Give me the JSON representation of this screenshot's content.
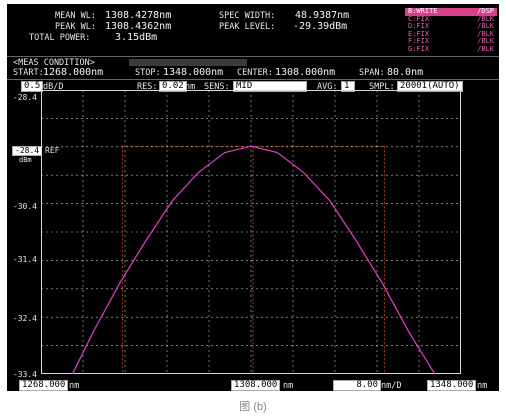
{
  "header": {
    "mean_wl_label": "MEAN WL:",
    "mean_wl_value": "1308.4278nm",
    "peak_wl_label": "PEAK WL:",
    "peak_wl_value": "1308.4362nm",
    "total_power_label": "TOTAL POWER:",
    "total_power_value": "3.15dBm",
    "spec_width_label": "SPEC WIDTH:",
    "spec_width_value": "48.9387nm",
    "peak_level_label": "PEAK LEVEL:",
    "peak_level_value": "-29.39dBm"
  },
  "traces": [
    {
      "name": "B:WRITE",
      "mode": "/DSP",
      "highlight": true
    },
    {
      "name": "C:FIX",
      "mode": "/BLK",
      "highlight": false
    },
    {
      "name": "D:FIX",
      "mode": "/BLK",
      "highlight": false
    },
    {
      "name": "E:FIX",
      "mode": "/BLK",
      "highlight": false
    },
    {
      "name": "F:FIX",
      "mode": "/BLK",
      "highlight": false
    },
    {
      "name": "G:FIX",
      "mode": "/BLK",
      "highlight": false
    }
  ],
  "meas": {
    "title": "<MEAS CONDITION>",
    "start_label": "START:",
    "start_value": "1268.000nm",
    "stop_label": "STOP:",
    "stop_value": "1348.000nm",
    "center_label": "CENTER:",
    "center_value": "1308.000nm",
    "span_label": "SPAN:",
    "span_value": "80.0nm"
  },
  "settings": {
    "scale_value": "0.5",
    "scale_unit": "dB/D",
    "res_label": "RES:",
    "res_value": "0.02",
    "res_unit": "nm",
    "sens_label": "SENS:",
    "sens_value": "MID",
    "avg_label": "AVG:",
    "avg_value": "1",
    "smpl_label": "SMPL:",
    "smpl_value": "20001(AUTO)"
  },
  "axis": {
    "ref_value": "-28.4",
    "ref_label": "REF",
    "ref_unit": "dBm",
    "y_ticks": [
      "-28.4",
      "-30.4",
      "-31.4",
      "-32.4",
      "-33.4"
    ]
  },
  "bottom": {
    "start_value": "1268.000",
    "start_unit": "nm",
    "center_value": "1308.000",
    "center_unit": "nm",
    "div_value": "8.00",
    "div_unit": "nm/D",
    "stop_value": "1348.000",
    "stop_unit": "nm"
  },
  "caption": "图 (b)",
  "colors": {
    "trace": "#e040c8",
    "grid": "#c8c8c8",
    "marker": "#d05010",
    "background": "#000000"
  },
  "chart_data": {
    "type": "line",
    "x_range_nm": [
      1268.0,
      1348.0
    ],
    "y_range_dBm": [
      -33.4,
      -28.4
    ],
    "peak": {
      "x_nm": 1308.4362,
      "y_dBm": -29.39
    },
    "series": [
      {
        "name": "",
        "x": [
          1274,
          1278,
          1283,
          1288,
          1293,
          1298,
          1303,
          1308,
          1313,
          1318,
          1323,
          1328,
          1333,
          1338,
          1343
        ],
        "y": [
          -33.4,
          -32.65,
          -31.8,
          -31.05,
          -30.35,
          -29.85,
          -29.5,
          -29.39,
          -29.5,
          -29.85,
          -30.35,
          -31.05,
          -31.8,
          -32.65,
          -33.4
        ]
      }
    ],
    "markers_x_nm": [
      1283.5,
      1308.4,
      1333.4
    ]
  }
}
